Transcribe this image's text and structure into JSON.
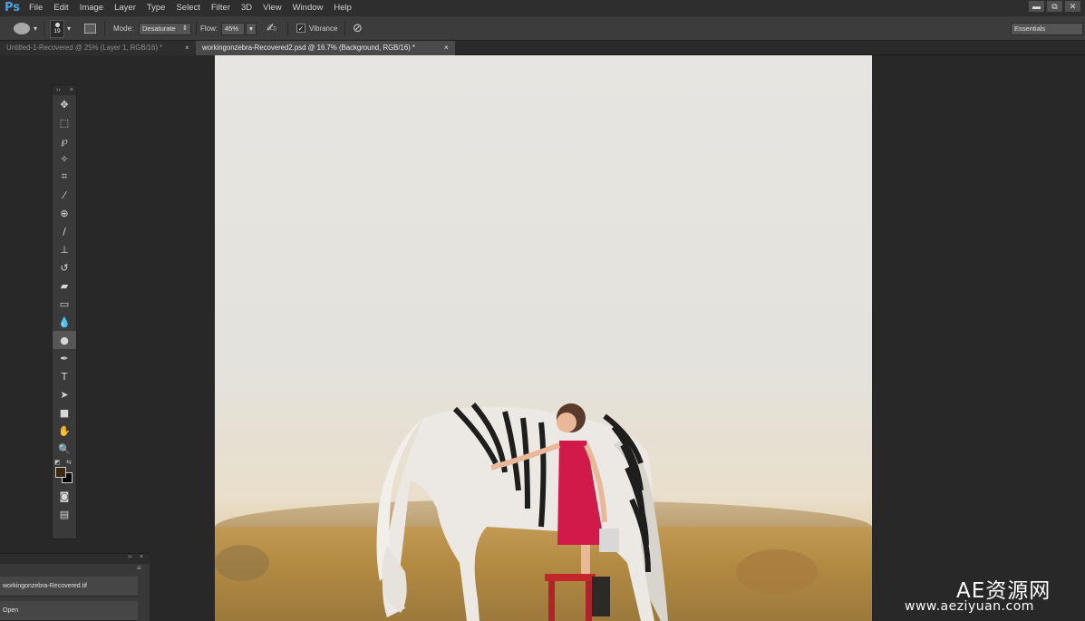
{
  "app": {
    "logo": "Ps"
  },
  "menu": [
    "File",
    "Edit",
    "Image",
    "Layer",
    "Type",
    "Select",
    "Filter",
    "3D",
    "View",
    "Window",
    "Help"
  ],
  "options": {
    "brush_size": "19",
    "mode_label": "Mode:",
    "mode_value": "Desaturate",
    "flow_label": "Flow:",
    "flow_value": "45%",
    "vibrance_label": "Vibrance",
    "workspace": "Essentials"
  },
  "tabs": [
    {
      "label": "Untitled-1-Recovered @ 25% (Layer 1, RGB/16) *",
      "active": false
    },
    {
      "label": "workingonzebra-Recovered2.psd @ 16.7% (Background, RGB/16) *",
      "active": true
    }
  ],
  "tools": [
    "move-tool",
    "marquee-tool",
    "lasso-tool",
    "magic-wand-tool",
    "crop-tool",
    "eyedropper-tool",
    "healing-brush-tool",
    "brush-tool",
    "clone-stamp-tool",
    "history-brush-tool",
    "eraser-tool",
    "gradient-tool",
    "blur-tool",
    "sponge-tool",
    "pen-tool",
    "type-tool",
    "path-selection-tool",
    "rectangle-tool",
    "hand-tool",
    "zoom-tool"
  ],
  "colors": {
    "foreground": "#3a2712",
    "background": "#000000",
    "accent": "#4aa3df"
  },
  "bottom_panel": {
    "rows": [
      "workingonzebra-Recovered.tif",
      "Open"
    ]
  },
  "watermark": {
    "title": "AE资源网",
    "url": "www.aeziyuan.com"
  }
}
